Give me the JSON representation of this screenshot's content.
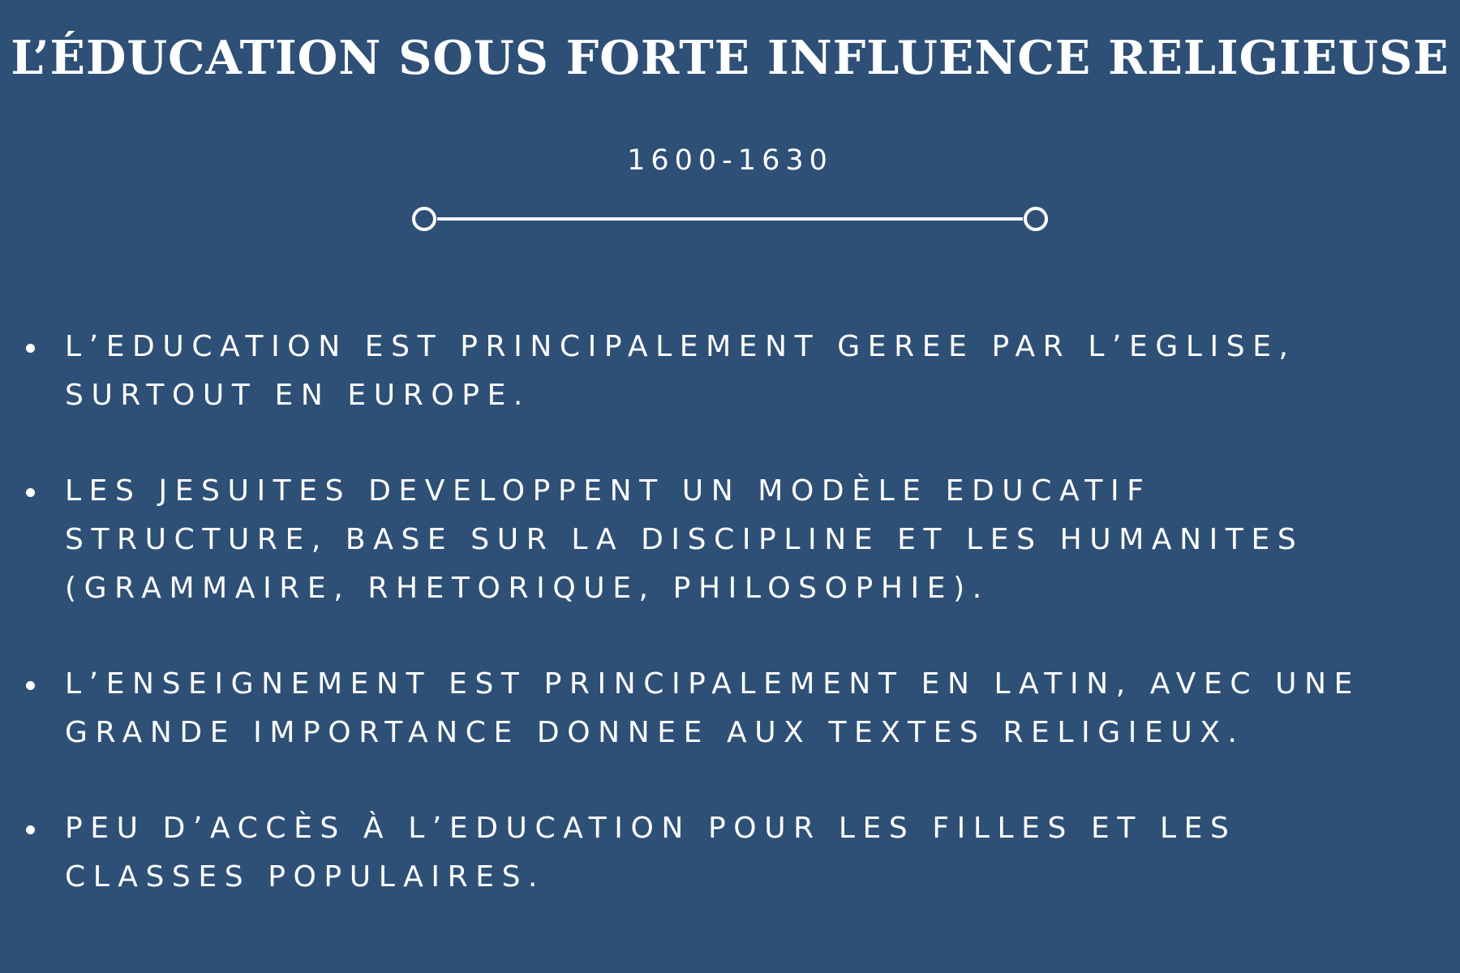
{
  "title": "L’ÉDUCATION SOUS FORTE INFLUENCE RELIGIEUSE",
  "period": "1600-1630",
  "bullets": [
    {
      "lines": [
        "L’EDUCATION EST PRINCIPALEMENT GEREE PAR L’EGLISE,",
        "SURTOUT EN EUROPE."
      ]
    },
    {
      "lines": [
        "LES JESUITES DEVELOPPENT UN MODÈLE EDUCATIF",
        "STRUCTURE, BASE SUR LA DISCIPLINE ET LES HUMANITES",
        "(GRAMMAIRE, RHETORIQUE, PHILOSOPHIE)."
      ]
    },
    {
      "lines": [
        "L’ENSEIGNEMENT EST PRINCIPALEMENT EN LATIN, AVEC UNE",
        "GRANDE IMPORTANCE DONNEE AUX TEXTES RELIGIEUX."
      ]
    },
    {
      "lines": [
        "PEU D’ACCÈS À L’EDUCATION POUR LES FILLES ET LES",
        "CLASSES POPULAIRES."
      ]
    }
  ],
  "colors": {
    "background": "#2e5077",
    "text": "#ffffff"
  }
}
